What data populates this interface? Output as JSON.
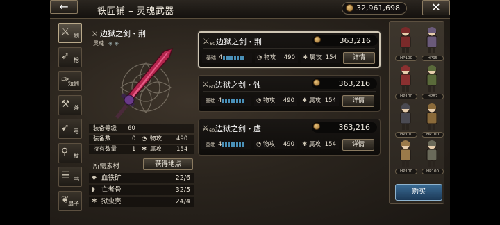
{
  "header": {
    "back_glyph": "←",
    "title": "铁匠铺 – 灵魂武器",
    "money": "32,961,698",
    "close_glyph": "✕"
  },
  "tabs": [
    {
      "label": "剑",
      "icon": "sword-icon",
      "glyph": "⚔",
      "active": true
    },
    {
      "label": "枪",
      "icon": "spear-icon",
      "glyph": "➶",
      "active": false
    },
    {
      "label": "短剑",
      "icon": "dagger-icon",
      "glyph": "✑",
      "active": false
    },
    {
      "label": "斧",
      "icon": "axe-icon",
      "glyph": "⚒",
      "active": false
    },
    {
      "label": "弓",
      "icon": "bow-icon",
      "glyph": "➹",
      "active": false
    },
    {
      "label": "杖",
      "icon": "staff-icon",
      "glyph": "⚲",
      "active": false
    },
    {
      "label": "书",
      "icon": "book-icon",
      "glyph": "☰",
      "active": false
    },
    {
      "label": "扇子",
      "icon": "fan-icon",
      "glyph": "❦",
      "active": false
    }
  ],
  "detail": {
    "name": "边狱之剑・荆",
    "soul_label": "灵魂",
    "soul_gems": "◈ ◈",
    "equip_level_label": "装备等级",
    "equip_level": "60",
    "equipped_label": "装备数",
    "equipped": "0",
    "owned_label": "持有数量",
    "owned": "1",
    "phys_atk_label": "物攻",
    "phys_atk": "490",
    "elem_atk_label": "属攻",
    "elem_atk": "154",
    "materials_label": "所需素材",
    "source_button": "获得地点",
    "materials": [
      {
        "name": "血铁矿",
        "count": "22/6",
        "icon": "ore-icon",
        "glyph": "◆"
      },
      {
        "name": "亡者骨",
        "count": "32/5",
        "icon": "bone-icon",
        "glyph": "◗"
      },
      {
        "name": "狱虫壳",
        "count": "24/4",
        "icon": "shell-icon",
        "glyph": "✱"
      }
    ]
  },
  "cards": [
    {
      "name": "边狱之剑・荆",
      "level": "60",
      "price": "363,216",
      "slot_label": "基础",
      "slot_num": "4",
      "phys_label": "物攻",
      "phys": "490",
      "elem_label": "属攻",
      "elem": "154",
      "button": "详情",
      "selected": true
    },
    {
      "name": "边狱之剑・蚀",
      "level": "60",
      "price": "363,216",
      "slot_label": "基础",
      "slot_num": "4",
      "phys_label": "物攻",
      "phys": "490",
      "elem_label": "属攻",
      "elem": "154",
      "button": "详情",
      "selected": false
    },
    {
      "name": "边狱之剑・虚",
      "level": "60",
      "price": "363,216",
      "slot_label": "基础",
      "slot_num": "4",
      "phys_label": "物攻",
      "phys": "490",
      "elem_label": "属攻",
      "elem": "154",
      "button": "详情",
      "selected": false
    }
  ],
  "characters": [
    {
      "hp": "HP100",
      "color": "#7a2a2a"
    },
    {
      "hp": "HP95",
      "color": "#6a5a7a"
    },
    {
      "hp": "HP100",
      "color": "#8a3030"
    },
    {
      "hp": "HP82",
      "color": "#5a6a3a"
    },
    {
      "hp": "HP100",
      "color": "#4a4a52"
    },
    {
      "hp": "HP100",
      "color": "#8a6a3a"
    },
    {
      "hp": "HP100",
      "color": "#9a7a4a"
    },
    {
      "hp": "HP100",
      "color": "#6a6a5a"
    }
  ],
  "buy_button": "购买"
}
